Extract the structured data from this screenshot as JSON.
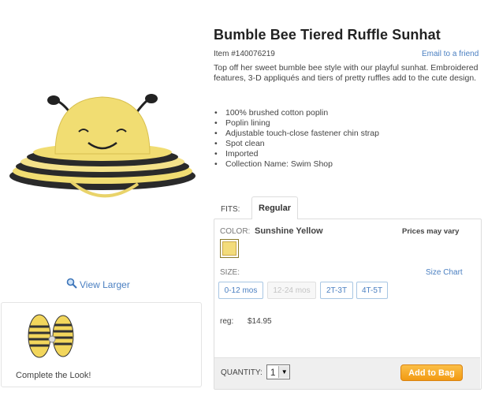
{
  "product": {
    "title": "Bumble Bee Tiered Ruffle Sunhat",
    "item_number": "Item #140076219",
    "email_friend": "Email to a friend",
    "description": "Top off her sweet bumble bee style with our playful sunhat. Embroidered features, 3-D appliqués and tiers of pretty ruffles add to the cute design.",
    "features": [
      "100% brushed cotton poplin",
      "Poplin lining",
      "Adjustable touch-close fastener chin strap",
      "Spot clean",
      "Imported",
      "Collection Name: Swim Shop"
    ]
  },
  "gallery": {
    "view_larger": "View Larger",
    "complete_the_look": "Complete the Look!"
  },
  "fits": {
    "label": "FITS:",
    "tabs": [
      {
        "label": "Regular",
        "active": true
      }
    ]
  },
  "color": {
    "label": "COLOR:",
    "value": "Sunshine Yellow",
    "prices_note": "Prices may vary",
    "swatch_color": "#f3dc7b"
  },
  "size": {
    "label": "SIZE:",
    "size_chart": "Size Chart",
    "options": [
      {
        "label": "0-12 mos",
        "available": true
      },
      {
        "label": "12-24 mos",
        "available": false
      },
      {
        "label": "2T-3T",
        "available": true
      },
      {
        "label": "4T-5T",
        "available": true
      }
    ]
  },
  "price": {
    "label": "reg:",
    "value": "$14.95"
  },
  "purchase": {
    "quantity_label": "QUANTITY:",
    "quantity_value": "1",
    "add_to_bag": "Add to Bag"
  },
  "colors": {
    "link": "#4a7fc1",
    "button": "#f5a623",
    "hat_yellow": "#f1dd72"
  }
}
